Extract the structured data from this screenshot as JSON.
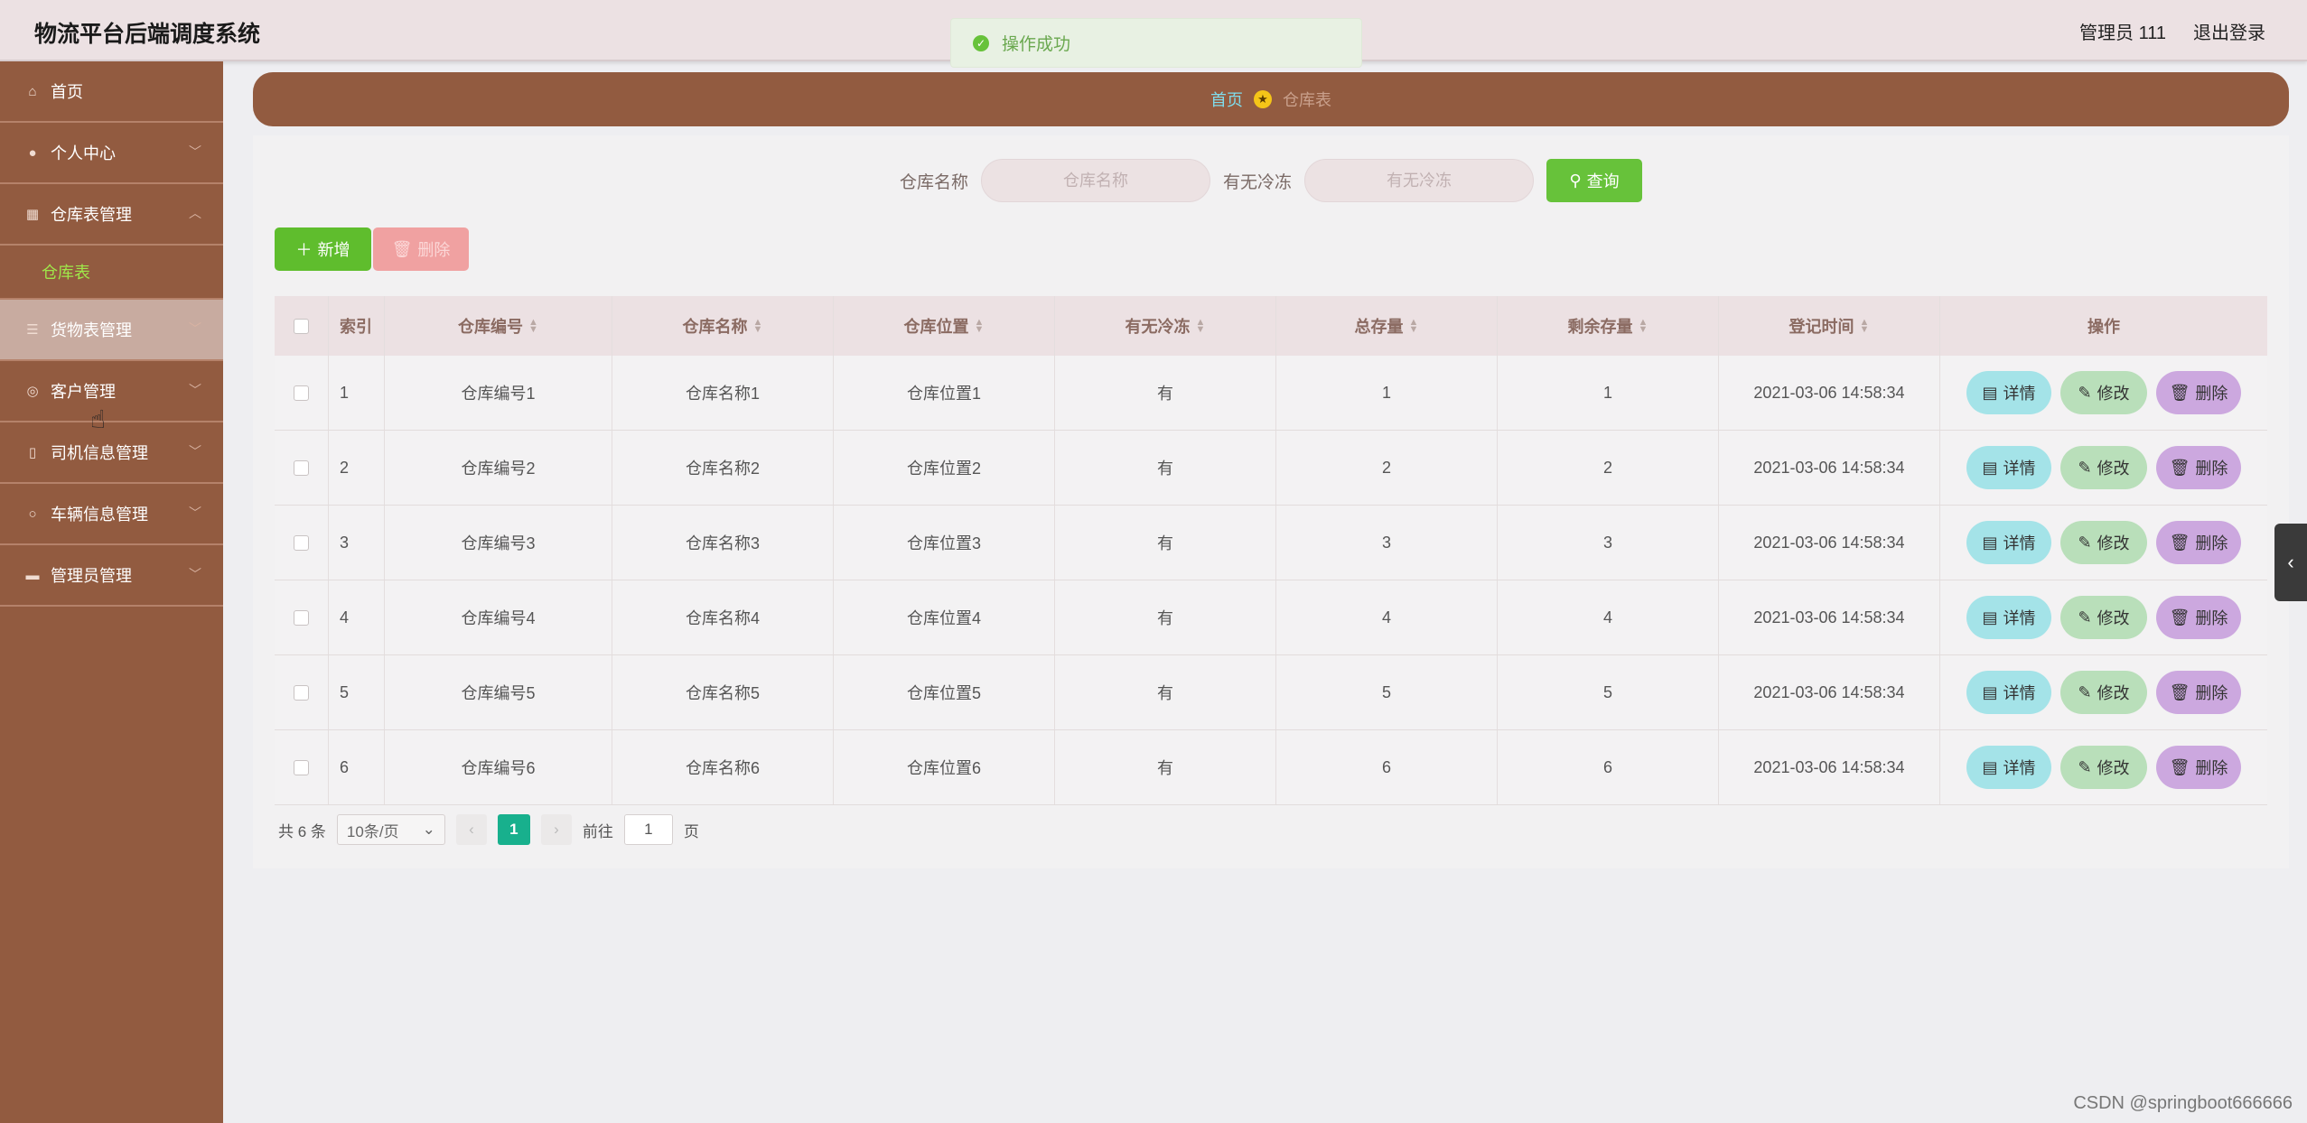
{
  "app": {
    "title": "物流平台后端调度系统"
  },
  "header": {
    "user_label": "管理员 111",
    "logout_label": "退出登录"
  },
  "toast": {
    "message": "操作成功"
  },
  "sidebar": {
    "items": [
      {
        "label": "首页",
        "icon": "home-icon"
      },
      {
        "label": "个人中心",
        "icon": "user-icon"
      },
      {
        "label": "仓库表管理",
        "icon": "grid-icon"
      },
      {
        "label": "货物表管理",
        "icon": "list-icon"
      },
      {
        "label": "客户管理",
        "icon": "globe-icon"
      },
      {
        "label": "司机信息管理",
        "icon": "mic-icon"
      },
      {
        "label": "车辆信息管理",
        "icon": "circle-icon"
      },
      {
        "label": "管理员管理",
        "icon": "monitor-icon"
      }
    ],
    "submenu": {
      "label": "仓库表"
    }
  },
  "breadcrumb": {
    "home": "首页",
    "current": "仓库表"
  },
  "search": {
    "name_label": "仓库名称",
    "name_placeholder": "仓库名称",
    "cold_label": "有无冷冻",
    "cold_placeholder": "有无冷冻",
    "query_label": "查询"
  },
  "actions": {
    "add_label": "新增",
    "delete_label": "删除"
  },
  "table": {
    "headers": [
      "索引",
      "仓库编号",
      "仓库名称",
      "仓库位置",
      "有无冷冻",
      "总存量",
      "剩余存量",
      "登记时间",
      "操作"
    ],
    "rows": [
      [
        "1",
        "仓库编号1",
        "仓库名称1",
        "仓库位置1",
        "有",
        "1",
        "1",
        "2021-03-06 14:58:34"
      ],
      [
        "2",
        "仓库编号2",
        "仓库名称2",
        "仓库位置2",
        "有",
        "2",
        "2",
        "2021-03-06 14:58:34"
      ],
      [
        "3",
        "仓库编号3",
        "仓库名称3",
        "仓库位置3",
        "有",
        "3",
        "3",
        "2021-03-06 14:58:34"
      ],
      [
        "4",
        "仓库编号4",
        "仓库名称4",
        "仓库位置4",
        "有",
        "4",
        "4",
        "2021-03-06 14:58:34"
      ],
      [
        "5",
        "仓库编号5",
        "仓库名称5",
        "仓库位置5",
        "有",
        "5",
        "5",
        "2021-03-06 14:58:34"
      ],
      [
        "6",
        "仓库编号6",
        "仓库名称6",
        "仓库位置6",
        "有",
        "6",
        "6",
        "2021-03-06 14:58:34"
      ]
    ],
    "row_actions": {
      "detail": "详情",
      "edit": "修改",
      "delete": "删除"
    }
  },
  "pagination": {
    "total_label": "共 6 条",
    "page_size": "10条/页",
    "current_page": "1",
    "goto_prefix": "前往",
    "goto_value": "1",
    "goto_suffix": "页"
  },
  "watermark": "CSDN @springboot666666"
}
